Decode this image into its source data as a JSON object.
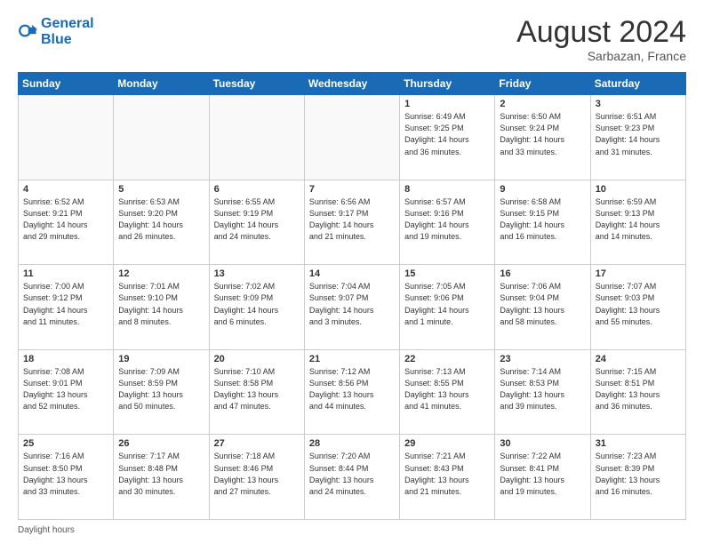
{
  "header": {
    "logo_line1": "General",
    "logo_line2": "Blue",
    "title": "August 2024",
    "subtitle": "Sarbazan, France"
  },
  "footer": {
    "label": "Daylight hours"
  },
  "days_of_week": [
    "Sunday",
    "Monday",
    "Tuesday",
    "Wednesday",
    "Thursday",
    "Friday",
    "Saturday"
  ],
  "weeks": [
    [
      {
        "num": "",
        "info": ""
      },
      {
        "num": "",
        "info": ""
      },
      {
        "num": "",
        "info": ""
      },
      {
        "num": "",
        "info": ""
      },
      {
        "num": "1",
        "info": "Sunrise: 6:49 AM\nSunset: 9:25 PM\nDaylight: 14 hours\nand 36 minutes."
      },
      {
        "num": "2",
        "info": "Sunrise: 6:50 AM\nSunset: 9:24 PM\nDaylight: 14 hours\nand 33 minutes."
      },
      {
        "num": "3",
        "info": "Sunrise: 6:51 AM\nSunset: 9:23 PM\nDaylight: 14 hours\nand 31 minutes."
      }
    ],
    [
      {
        "num": "4",
        "info": "Sunrise: 6:52 AM\nSunset: 9:21 PM\nDaylight: 14 hours\nand 29 minutes."
      },
      {
        "num": "5",
        "info": "Sunrise: 6:53 AM\nSunset: 9:20 PM\nDaylight: 14 hours\nand 26 minutes."
      },
      {
        "num": "6",
        "info": "Sunrise: 6:55 AM\nSunset: 9:19 PM\nDaylight: 14 hours\nand 24 minutes."
      },
      {
        "num": "7",
        "info": "Sunrise: 6:56 AM\nSunset: 9:17 PM\nDaylight: 14 hours\nand 21 minutes."
      },
      {
        "num": "8",
        "info": "Sunrise: 6:57 AM\nSunset: 9:16 PM\nDaylight: 14 hours\nand 19 minutes."
      },
      {
        "num": "9",
        "info": "Sunrise: 6:58 AM\nSunset: 9:15 PM\nDaylight: 14 hours\nand 16 minutes."
      },
      {
        "num": "10",
        "info": "Sunrise: 6:59 AM\nSunset: 9:13 PM\nDaylight: 14 hours\nand 14 minutes."
      }
    ],
    [
      {
        "num": "11",
        "info": "Sunrise: 7:00 AM\nSunset: 9:12 PM\nDaylight: 14 hours\nand 11 minutes."
      },
      {
        "num": "12",
        "info": "Sunrise: 7:01 AM\nSunset: 9:10 PM\nDaylight: 14 hours\nand 8 minutes."
      },
      {
        "num": "13",
        "info": "Sunrise: 7:02 AM\nSunset: 9:09 PM\nDaylight: 14 hours\nand 6 minutes."
      },
      {
        "num": "14",
        "info": "Sunrise: 7:04 AM\nSunset: 9:07 PM\nDaylight: 14 hours\nand 3 minutes."
      },
      {
        "num": "15",
        "info": "Sunrise: 7:05 AM\nSunset: 9:06 PM\nDaylight: 14 hours\nand 1 minute."
      },
      {
        "num": "16",
        "info": "Sunrise: 7:06 AM\nSunset: 9:04 PM\nDaylight: 13 hours\nand 58 minutes."
      },
      {
        "num": "17",
        "info": "Sunrise: 7:07 AM\nSunset: 9:03 PM\nDaylight: 13 hours\nand 55 minutes."
      }
    ],
    [
      {
        "num": "18",
        "info": "Sunrise: 7:08 AM\nSunset: 9:01 PM\nDaylight: 13 hours\nand 52 minutes."
      },
      {
        "num": "19",
        "info": "Sunrise: 7:09 AM\nSunset: 8:59 PM\nDaylight: 13 hours\nand 50 minutes."
      },
      {
        "num": "20",
        "info": "Sunrise: 7:10 AM\nSunset: 8:58 PM\nDaylight: 13 hours\nand 47 minutes."
      },
      {
        "num": "21",
        "info": "Sunrise: 7:12 AM\nSunset: 8:56 PM\nDaylight: 13 hours\nand 44 minutes."
      },
      {
        "num": "22",
        "info": "Sunrise: 7:13 AM\nSunset: 8:55 PM\nDaylight: 13 hours\nand 41 minutes."
      },
      {
        "num": "23",
        "info": "Sunrise: 7:14 AM\nSunset: 8:53 PM\nDaylight: 13 hours\nand 39 minutes."
      },
      {
        "num": "24",
        "info": "Sunrise: 7:15 AM\nSunset: 8:51 PM\nDaylight: 13 hours\nand 36 minutes."
      }
    ],
    [
      {
        "num": "25",
        "info": "Sunrise: 7:16 AM\nSunset: 8:50 PM\nDaylight: 13 hours\nand 33 minutes."
      },
      {
        "num": "26",
        "info": "Sunrise: 7:17 AM\nSunset: 8:48 PM\nDaylight: 13 hours\nand 30 minutes."
      },
      {
        "num": "27",
        "info": "Sunrise: 7:18 AM\nSunset: 8:46 PM\nDaylight: 13 hours\nand 27 minutes."
      },
      {
        "num": "28",
        "info": "Sunrise: 7:20 AM\nSunset: 8:44 PM\nDaylight: 13 hours\nand 24 minutes."
      },
      {
        "num": "29",
        "info": "Sunrise: 7:21 AM\nSunset: 8:43 PM\nDaylight: 13 hours\nand 21 minutes."
      },
      {
        "num": "30",
        "info": "Sunrise: 7:22 AM\nSunset: 8:41 PM\nDaylight: 13 hours\nand 19 minutes."
      },
      {
        "num": "31",
        "info": "Sunrise: 7:23 AM\nSunset: 8:39 PM\nDaylight: 13 hours\nand 16 minutes."
      }
    ]
  ]
}
